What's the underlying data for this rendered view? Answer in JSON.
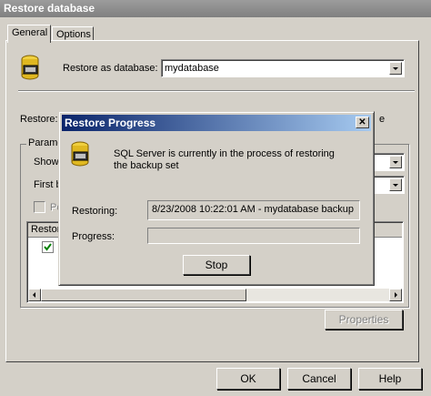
{
  "window": {
    "title": "Restore database"
  },
  "tabs": [
    {
      "label": "General"
    },
    {
      "label": "Options"
    }
  ],
  "general": {
    "restore_as_label": "Restore as database:",
    "restore_as_value": "mydatabase",
    "restore_label": "Restore:",
    "restore_trailing": "e",
    "params_group_label": "Parame",
    "show_label": "Show",
    "first_label": "First b",
    "point_label": "Po",
    "grid_header": "Restore",
    "properties_button": "Properties"
  },
  "footer": {
    "ok": "OK",
    "cancel": "Cancel",
    "help": "Help"
  },
  "progress_dialog": {
    "title": "Restore Progress",
    "close_glyph": "✕",
    "message": "SQL Server is currently in the process of restoring the backup set",
    "restoring_label": "Restoring:",
    "restoring_value": "8/23/2008 10:22:01 AM - mydatabase backup",
    "progress_label": "Progress:",
    "progress_fraction": 0,
    "stop_button": "Stop"
  },
  "icons": {
    "database": "database-icon",
    "checkbox": "checkbox-icon",
    "check": "checkmark-icon",
    "close": "close-icon",
    "dropdown": "chevron-down-icon",
    "scroll_left": "arrow-left-icon",
    "scroll_right": "arrow-right-icon"
  },
  "colors": {
    "face": "#d4d0c8",
    "active_title_start": "#0a246a",
    "active_title_end": "#a6caf0",
    "inactive_title": "#808080",
    "check": "#008000"
  }
}
